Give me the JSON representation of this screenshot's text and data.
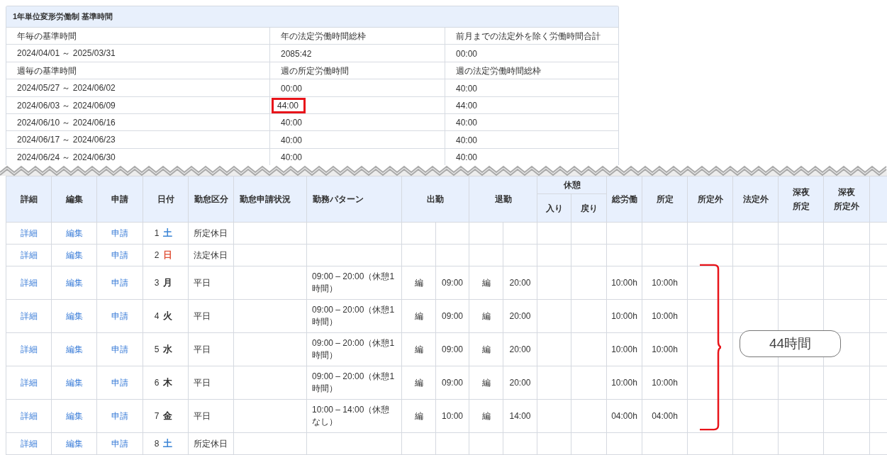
{
  "summary_panel": {
    "title": "1年単位変形労働制 基準時間",
    "rows": [
      {
        "cells": [
          {
            "text": "年毎の基準時間",
            "highlighted": false
          },
          {
            "text": "年の法定労働時間総枠",
            "highlighted": false
          },
          {
            "text": "前月までの法定外を除く労働時間合計",
            "highlighted": false
          }
        ]
      },
      {
        "cells": [
          {
            "text": "2024/04/01 ～ 2025/03/31",
            "highlighted": false
          },
          {
            "text": "2085:42",
            "highlighted": false
          },
          {
            "text": "00:00",
            "highlighted": false
          }
        ]
      },
      {
        "cells": [
          {
            "text": "週毎の基準時間",
            "highlighted": false
          },
          {
            "text": "週の所定労働時間",
            "highlighted": false
          },
          {
            "text": "週の法定労働時間総枠",
            "highlighted": false
          }
        ]
      },
      {
        "cells": [
          {
            "text": "2024/05/27 ～ 2024/06/02",
            "highlighted": false
          },
          {
            "text": "00:00",
            "highlighted": false
          },
          {
            "text": "40:00",
            "highlighted": false
          }
        ]
      },
      {
        "cells": [
          {
            "text": "2024/06/03 ～ 2024/06/09",
            "highlighted": false
          },
          {
            "text": "44:00",
            "highlighted": true
          },
          {
            "text": "44:00",
            "highlighted": false
          }
        ]
      },
      {
        "cells": [
          {
            "text": "2024/06/10 ～ 2024/06/16",
            "highlighted": false
          },
          {
            "text": "40:00",
            "highlighted": false
          },
          {
            "text": "40:00",
            "highlighted": false
          }
        ]
      },
      {
        "cells": [
          {
            "text": "2024/06/17 ～ 2024/06/23",
            "highlighted": false
          },
          {
            "text": "40:00",
            "highlighted": false
          },
          {
            "text": "40:00",
            "highlighted": false
          }
        ]
      },
      {
        "cells": [
          {
            "text": "2024/06/24 ～ 2024/06/30",
            "highlighted": false
          },
          {
            "text": "40:00",
            "highlighted": false
          },
          {
            "text": "40:00",
            "highlighted": false
          }
        ]
      }
    ]
  },
  "attendance_table": {
    "columns": [
      {
        "kind": "single",
        "label": "詳細"
      },
      {
        "kind": "single",
        "label": "編集"
      },
      {
        "kind": "single",
        "label": "申請"
      },
      {
        "kind": "single",
        "label": "日付"
      },
      {
        "kind": "single",
        "label": "勤怠区分"
      },
      {
        "kind": "left",
        "label": "勤怠申請状況"
      },
      {
        "kind": "left",
        "label": "勤務パターン"
      },
      {
        "kind": "pair",
        "label": "出勤"
      },
      {
        "kind": "pair",
        "label": "退勤"
      },
      {
        "kind": "group",
        "label": "休憩",
        "children": [
          "入り",
          "戻り"
        ]
      },
      {
        "kind": "single",
        "label": "総労働"
      },
      {
        "kind": "single",
        "label": "所定"
      },
      {
        "kind": "single",
        "label": "所定外"
      },
      {
        "kind": "single",
        "label": "法定外"
      },
      {
        "kind": "stacked",
        "lines": [
          "深夜",
          "所定"
        ]
      },
      {
        "kind": "stacked",
        "lines": [
          "深夜",
          "所定外"
        ]
      }
    ],
    "rows": [
      {
        "links": [
          "詳細",
          "編集",
          "申請"
        ],
        "day": {
          "number": "1",
          "weekday": "土",
          "color": "#3d86d6"
        },
        "category": "所定休日"
      },
      {
        "links": [
          "詳細",
          "編集",
          "申請"
        ],
        "day": {
          "number": "2",
          "weekday": "日",
          "color": "#e0533a"
        },
        "category": "法定休日"
      },
      {
        "links": [
          "詳細",
          "編集",
          "申請"
        ],
        "day": {
          "number": "3",
          "weekday": "月",
          "color": "#333333"
        },
        "category": "平日",
        "pattern": "09:00 – 20:00（休憩1時間）",
        "clock_in": {
          "mark": "編",
          "time": "09:00"
        },
        "clock_out": {
          "mark": "編",
          "time": "20:00"
        },
        "total": "10:00h",
        "scheduled": "10:00h"
      },
      {
        "links": [
          "詳細",
          "編集",
          "申請"
        ],
        "day": {
          "number": "4",
          "weekday": "火",
          "color": "#333333"
        },
        "category": "平日",
        "pattern": "09:00 – 20:00（休憩1時間）",
        "clock_in": {
          "mark": "編",
          "time": "09:00"
        },
        "clock_out": {
          "mark": "編",
          "time": "20:00"
        },
        "total": "10:00h",
        "scheduled": "10:00h"
      },
      {
        "links": [
          "詳細",
          "編集",
          "申請"
        ],
        "day": {
          "number": "5",
          "weekday": "水",
          "color": "#333333"
        },
        "category": "平日",
        "pattern": "09:00 – 20:00（休憩1時間）",
        "clock_in": {
          "mark": "編",
          "time": "09:00"
        },
        "clock_out": {
          "mark": "編",
          "time": "20:00"
        },
        "total": "10:00h",
        "scheduled": "10:00h"
      },
      {
        "links": [
          "詳細",
          "編集",
          "申請"
        ],
        "day": {
          "number": "6",
          "weekday": "木",
          "color": "#333333"
        },
        "category": "平日",
        "pattern": "09:00 – 20:00（休憩1時間）",
        "clock_in": {
          "mark": "編",
          "time": "09:00"
        },
        "clock_out": {
          "mark": "編",
          "time": "20:00"
        },
        "total": "10:00h",
        "scheduled": "10:00h"
      },
      {
        "links": [
          "詳細",
          "編集",
          "申請"
        ],
        "day": {
          "number": "7",
          "weekday": "金",
          "color": "#333333"
        },
        "category": "平日",
        "pattern": "10:00 – 14:00（休憩なし）",
        "clock_in": {
          "mark": "編",
          "time": "10:00"
        },
        "clock_out": {
          "mark": "編",
          "time": "14:00"
        },
        "total": "04:00h",
        "scheduled": "04:00h"
      },
      {
        "links": [
          "詳細",
          "編集",
          "申請"
        ],
        "day": {
          "number": "8",
          "weekday": "土",
          "color": "#3d86d6"
        },
        "category": "所定休日"
      }
    ]
  },
  "annotation": {
    "label": "44時間"
  }
}
